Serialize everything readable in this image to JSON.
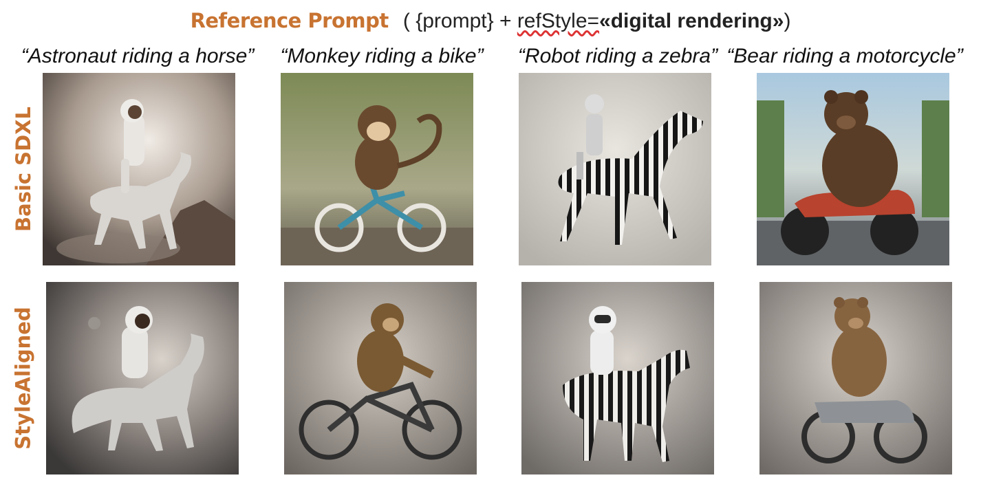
{
  "header": {
    "title": "Reference Prompt",
    "formula_start": "( {prompt} + ",
    "formula_key": "refStyle=",
    "formula_value": "«digital rendering»",
    "formula_end": ")"
  },
  "captions": [
    "“Astronaut riding a horse”",
    "“Monkey riding a bike”",
    "“Robot riding a zebra”",
    "“Bear riding a motorcycle”"
  ],
  "rows": [
    {
      "label": "Basic SDXL"
    },
    {
      "label": "StyleAligned"
    }
  ],
  "colors": {
    "accent": "#c87331",
    "text": "#111111"
  },
  "icons": {
    "astronaut": "astronaut-on-horse-image",
    "monkey": "monkey-on-bike-image",
    "robot": "robot-on-zebra-image",
    "bear": "bear-on-motorcycle-image"
  }
}
